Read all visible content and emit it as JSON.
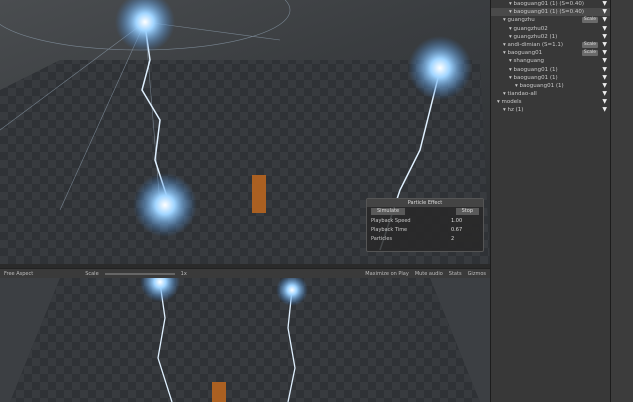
{
  "particle_effect": {
    "title": "Particle Effect",
    "simulate": "Simulate",
    "stop": "Stop",
    "rows": [
      {
        "label": "Playback Speed",
        "value": "1.00"
      },
      {
        "label": "Playback Time",
        "value": "0.67"
      },
      {
        "label": "Particles",
        "value": "2"
      }
    ]
  },
  "game_toolbar": {
    "aspect": "Free Aspect",
    "scale_label": "Scale",
    "scale_value": "1x",
    "maximize": "Maximize on Play",
    "mute": "Mute audio",
    "stats": "Stats",
    "gizmos": "Gizmos"
  },
  "hierarchy": [
    {
      "label": "baoguang01 (1) (S=0.40)",
      "indent": 3,
      "tag": ""
    },
    {
      "label": "baoguang01 (1) (S=0.40)",
      "indent": 3,
      "tag": "",
      "selected": true
    },
    {
      "label": "guangzhu",
      "indent": 2,
      "tag": "Scale"
    },
    {
      "label": "guangzhu02",
      "indent": 3,
      "tag": ""
    },
    {
      "label": "guangzhu02 (1)",
      "indent": 3,
      "tag": ""
    },
    {
      "label": "andi-dimian (S=1.1)",
      "indent": 2,
      "tag": "Scale"
    },
    {
      "label": "baoguang01",
      "indent": 2,
      "tag": "Scale"
    },
    {
      "label": "shanguang",
      "indent": 3,
      "tag": ""
    },
    {
      "label": "baoguang01 (1)",
      "indent": 3,
      "tag": ""
    },
    {
      "label": "baoguang01 (1)",
      "indent": 3,
      "tag": ""
    },
    {
      "label": "baoguang01 (1)",
      "indent": 4,
      "tag": ""
    },
    {
      "label": "tiandao-all",
      "indent": 2,
      "tag": ""
    },
    {
      "label": "models",
      "indent": 1,
      "tag": ""
    },
    {
      "label": "hz (1)",
      "indent": 2,
      "tag": ""
    }
  ]
}
